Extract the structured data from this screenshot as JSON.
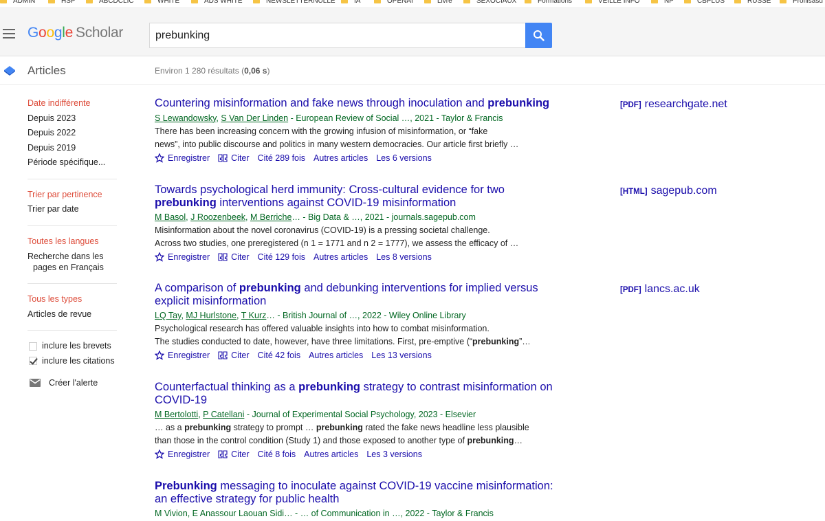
{
  "bookmarks": [
    "ADMIN",
    "HSP",
    "ABCDCLIC",
    "WHITE",
    "ADS WHITE",
    "NEWSLETTERNULLE",
    "IA",
    "OPENAI",
    "Livre",
    "SEXOCIAUX",
    "Formations",
    "VEILLE INFO",
    "NP",
    "CBPLUS",
    "RUSSE",
    "Profilsasu"
  ],
  "header": {
    "logo_letters": [
      "G",
      "o",
      "o",
      "g",
      "l",
      "e"
    ],
    "logo_scholar": "Scholar",
    "search_value": "prebunking",
    "search_icon": "search-icon"
  },
  "subheader": {
    "section": "Articles",
    "results_prefix": "Environ 1 280 résultats (",
    "results_time": "0,06 s",
    "results_suffix": ")"
  },
  "sidebar": {
    "date": [
      "Date indifférente",
      "Depuis 2023",
      "Depuis 2022",
      "Depuis 2019",
      "Période spécifique..."
    ],
    "sort": [
      "Trier par pertinence",
      "Trier par date"
    ],
    "languages": {
      "any": "Toutes les langues",
      "french_line1": "Recherche dans les",
      "french_line2": "pages en Français"
    },
    "types": [
      "Tous les types",
      "Articles de revue"
    ],
    "checks": [
      {
        "label": "inclure les brevets",
        "checked": false
      },
      {
        "label": "inclure les citations",
        "checked": true
      }
    ],
    "alert": "Créer l'alerte"
  },
  "actions": {
    "save": "Enregistrer",
    "cite": "Citer",
    "related": "Autres articles"
  },
  "results": [
    {
      "title": [
        {
          "t": "Countering misinformation and fake news through inoculation and "
        },
        {
          "t": "prebunking",
          "b": true
        }
      ],
      "authors": [
        "S Lewandowsky",
        "S Van Der Linden"
      ],
      "source": " - European Review of Social …, 2021 - Taylor & Francis",
      "snippet1": [
        {
          "t": "There has been increasing concern with the growing infusion of misinformation, or “fake"
        }
      ],
      "snippet2": [
        {
          "t": "news”, into public discourse and politics in many western democracies. Our article first briefly …"
        }
      ],
      "cited": "Cité 289 fois",
      "versions": "Les 6 versions",
      "side_type": "[PDF]",
      "side_domain": "researchgate.net"
    },
    {
      "title": [
        {
          "t": "Towards psychological herd immunity: Cross-cultural evidence for two "
        },
        {
          "t": "prebunking",
          "b": true
        },
        {
          "t": " interventions against COVID-19 misinformation"
        }
      ],
      "authors": [
        "M Basol",
        "J Roozenbeek",
        "M Berriche"
      ],
      "source": "… - Big Data & …, 2021 - journals.sagepub.com",
      "snippet1": [
        {
          "t": "Misinformation about the novel coronavirus (COVID-19) is a pressing societal challenge."
        }
      ],
      "snippet2": [
        {
          "t": "Across two studies, one preregistered (n 1 = 1771 and n 2 = 1777), we assess the efficacy of …"
        }
      ],
      "cited": "Cité 129 fois",
      "versions": "Les 8 versions",
      "side_type": "[HTML]",
      "side_domain": "sagepub.com"
    },
    {
      "title": [
        {
          "t": "A comparison of "
        },
        {
          "t": "prebunking",
          "b": true
        },
        {
          "t": " and debunking interventions for implied versus explicit misinformation"
        }
      ],
      "authors": [
        "LQ Tay",
        "MJ Hurlstone",
        "T Kurz"
      ],
      "source": "… - British Journal of …, 2022 - Wiley Online Library",
      "snippet1": [
        {
          "t": "Psychological research has offered valuable insights into how to combat misinformation."
        }
      ],
      "snippet2": [
        {
          "t": "The studies conducted to date, however, have three limitations. First, pre-emptive (“"
        },
        {
          "t": "prebunking",
          "b": true
        },
        {
          "t": "”…"
        }
      ],
      "cited": "Cité 42 fois",
      "versions": "Les 13 versions",
      "side_type": "[PDF]",
      "side_domain": "lancs.ac.uk"
    },
    {
      "title": [
        {
          "t": "Counterfactual thinking as a "
        },
        {
          "t": "prebunking",
          "b": true
        },
        {
          "t": " strategy to contrast misinformation on COVID-19"
        }
      ],
      "authors": [
        "M Bertolotti",
        "P Catellani"
      ],
      "source": " - Journal of Experimental Social Psychology, 2023 - Elsevier",
      "snippet1": [
        {
          "t": "… as a "
        },
        {
          "t": "prebunking",
          "b": true
        },
        {
          "t": " strategy to prompt … "
        },
        {
          "t": "prebunking",
          "b": true
        },
        {
          "t": " rated the fake news headline less plausible"
        }
      ],
      "snippet2": [
        {
          "t": "than those in the control condition (Study 1) and those exposed to another type of "
        },
        {
          "t": "prebunking",
          "b": true
        },
        {
          "t": "…"
        }
      ],
      "cited": "Cité 8 fois",
      "versions": "Les 3 versions",
      "side_type": "",
      "side_domain": ""
    },
    {
      "title": [
        {
          "t": "Prebunking",
          "b": true
        },
        {
          "t": " messaging to inoculate against COVID-19 vaccine misinformation: an effective strategy for public health"
        }
      ],
      "authors_plain": "M Vivion, E Anassour Laouan Sidi… - … of Communication in …, 2022 - Taylor & Francis",
      "side_type": "",
      "side_domain": ""
    }
  ]
}
